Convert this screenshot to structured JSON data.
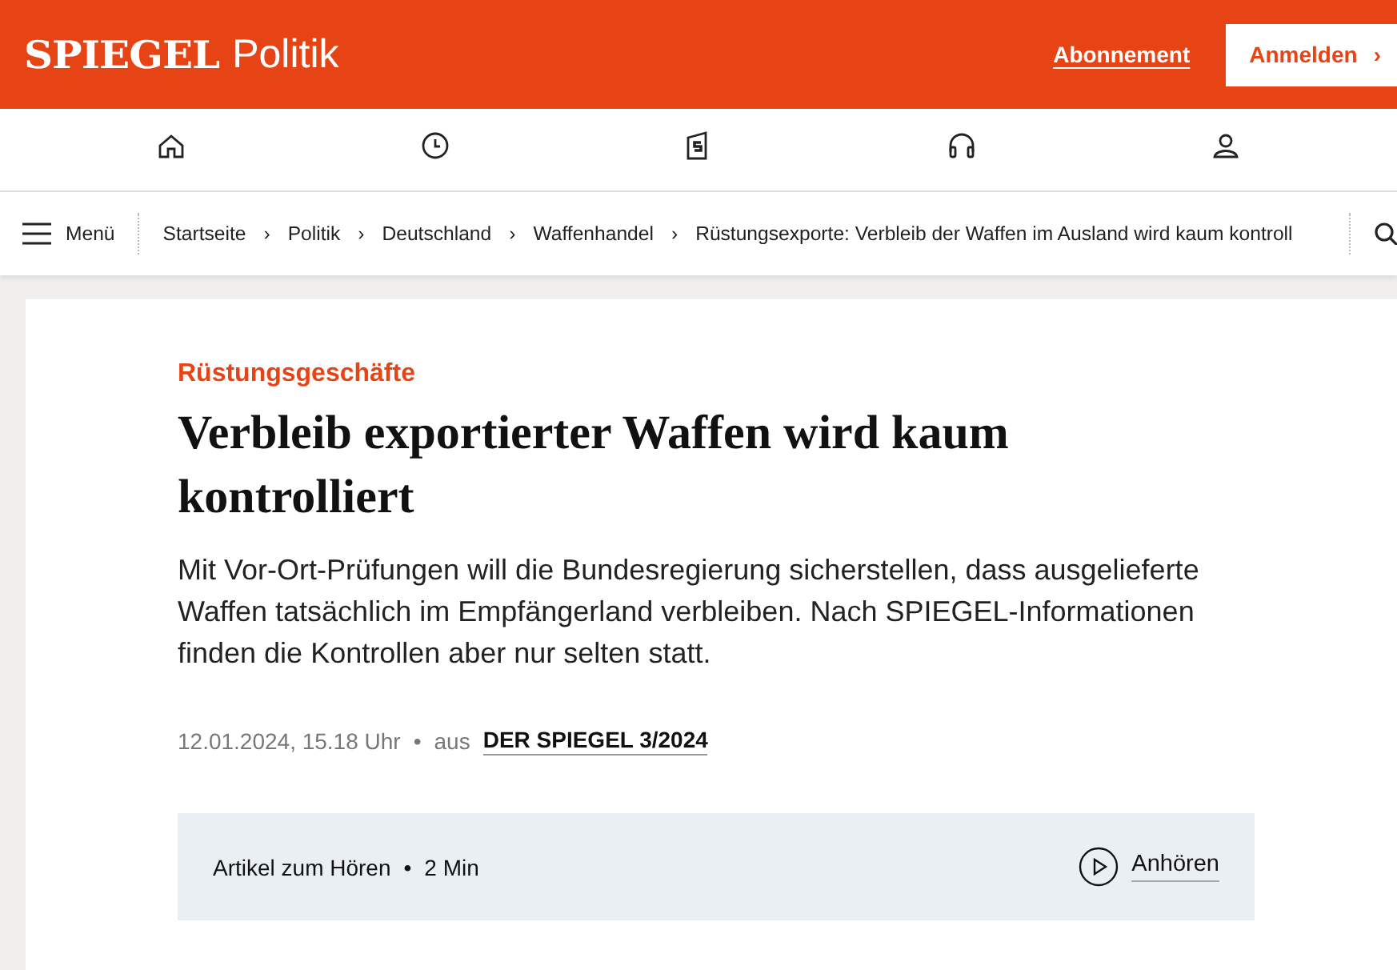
{
  "header": {
    "logo": "SPIEGEL",
    "section": "Politik",
    "subscribe": "Abonnement",
    "login": "Anmelden",
    "login_caret": "›"
  },
  "nav_icons": [
    {
      "kind": "home"
    },
    {
      "kind": "clock"
    },
    {
      "kind": "magazine"
    },
    {
      "kind": "headphones"
    },
    {
      "kind": "person"
    }
  ],
  "breadcrumb": {
    "menu": "Menü",
    "items": [
      "Startseite",
      "Politik",
      "Deutschland",
      "Waffenhandel",
      "Rüstungsexporte: Verbleib der Waffen im Ausland wird kaum kontroll"
    ],
    "separator": "›"
  },
  "article": {
    "kicker": "Rüstungsgeschäfte",
    "title": "Verbleib exportierter Waffen wird kaum kontrolliert",
    "teaser": "Mit Vor-Ort-Prüfungen will die Bundesregierung sicherstellen, dass ausgelieferte Waffen tatsächlich im Empfängerland verbleiben. Nach SPIEGEL-Informationen finden die Kontrollen aber nur selten statt.",
    "date": "12.01.2024, 15.18 Uhr",
    "bullet": "•",
    "source_prefix": "aus",
    "source": "DER SPIEGEL 3/2024"
  },
  "audio": {
    "label": "Artikel zum Hören",
    "bullet": "•",
    "duration": "2 Min",
    "button": "Anhören"
  }
}
